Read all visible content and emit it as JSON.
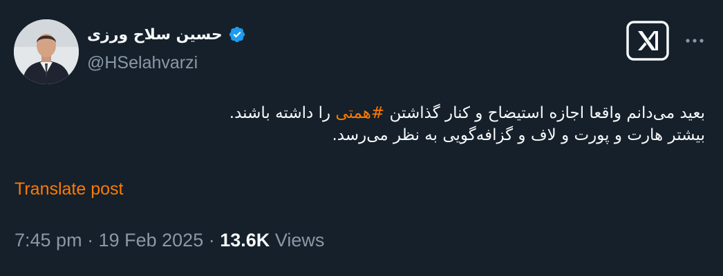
{
  "author": {
    "display_name": "حسین سلاح ورزی",
    "handle": "@HSelahvarzi",
    "verified": true,
    "verified_icon": "verified-badge-icon",
    "avatar_icon": "profile-photo"
  },
  "header": {
    "logo_icon": "x-logo-icon",
    "more_icon": "more-options-icon"
  },
  "tweet": {
    "line1_before": "بعید می‌دانم واقعا اجازه استیضاح و کنار گذاشتن ",
    "hashtag": "#همتی",
    "line1_after": " را داشته باشند.",
    "line2": "بیشتر هارت و پورت و لاف و گزافه‌گویی به نظر می‌رسد."
  },
  "translate_label": "Translate post",
  "meta": {
    "time": "7:45 pm",
    "separator": "·",
    "date": "19 Feb 2025",
    "views_count": "13.6K",
    "views_label": "Views"
  },
  "colors": {
    "background": "#15202b",
    "text": "#f7f9f9",
    "muted": "#8b98a5",
    "accent": "#ff7a00",
    "verified": "#1d9bf0"
  }
}
